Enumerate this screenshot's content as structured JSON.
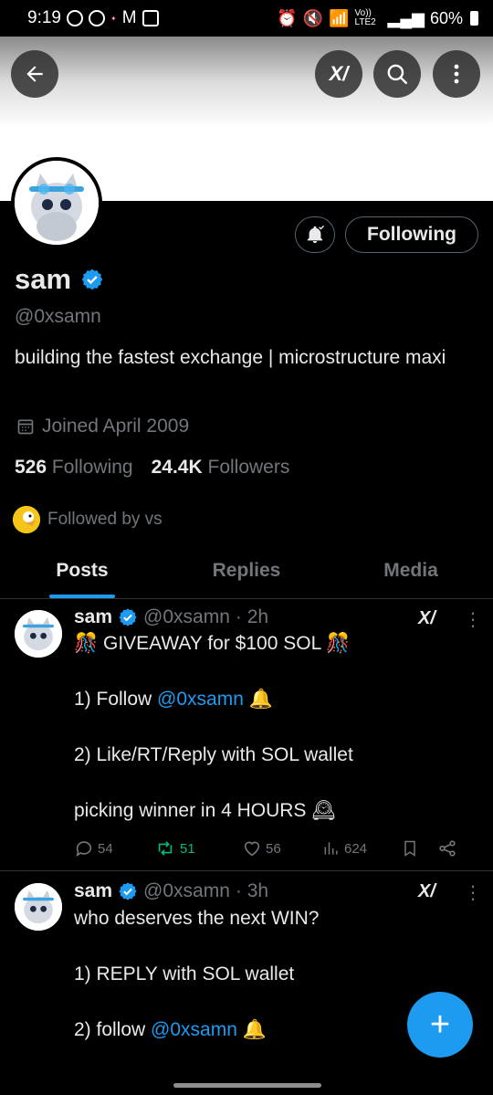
{
  "status_bar": {
    "time": "9:19",
    "network": "Vo)) LTE2",
    "battery": "60%"
  },
  "header": {
    "back_icon": "arrow-left-icon",
    "grok_label": "X/",
    "search_icon": "search-icon",
    "more_icon": "more-vertical-icon"
  },
  "profile": {
    "name": "sam",
    "handle": "@0xsamn",
    "bio": "building the fastest exchange | microstructure maxi",
    "joined": "Joined April 2009",
    "following_count": "526",
    "following_label": "Following",
    "followers_count": "24.4K",
    "followers_label": "Followers",
    "followed_by": "Followed by vs",
    "follow_button": "Following"
  },
  "tabs": [
    {
      "label": "Posts",
      "active": true
    },
    {
      "label": "Replies",
      "active": false
    },
    {
      "label": "Media",
      "active": false
    }
  ],
  "tweets": [
    {
      "name": "sam",
      "handle": "@0xsamn",
      "time": "· 2h",
      "lines": [
        "🎊 GIVEAWAY for $100 SOL 🎊",
        "",
        "1) Follow |@0xsamn| 🔔",
        "",
        "2) Like/RT/Reply with SOL wallet",
        "",
        "picking winner in 4 HOURS 🕰"
      ],
      "line1": "🎊 GIVEAWAY for $100 SOL 🎊",
      "line2_prefix": "1) Follow ",
      "line2_mention": "@0xsamn",
      "line2_suffix": " 🔔",
      "line3": "2) Like/RT/Reply with SOL wallet",
      "line4": "picking winner in 4 HOURS 🕰",
      "replies": "54",
      "reposts": "51",
      "likes": "56",
      "views": "624"
    },
    {
      "name": "sam",
      "handle": "@0xsamn",
      "time": "· 3h",
      "line1": "who deserves the next WIN?",
      "line2": "1) REPLY with SOL wallet",
      "line3_prefix": "2) follow ",
      "line3_mention": "@0xsamn",
      "line3_suffix": " 🔔"
    }
  ],
  "fab": {
    "label": "+"
  },
  "colors": {
    "accent": "#1d9bf0",
    "repost": "#00ba7c",
    "muted": "#71767b",
    "background": "#000000"
  }
}
